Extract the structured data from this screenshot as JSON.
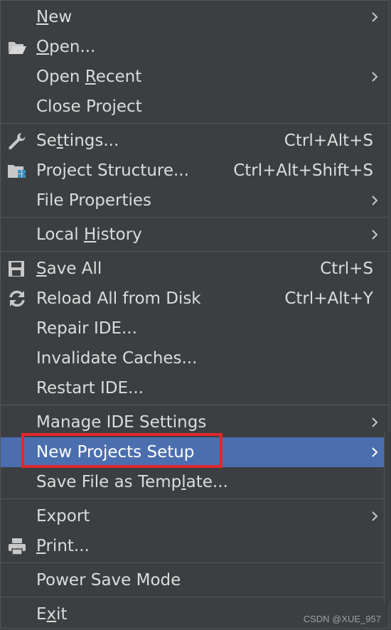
{
  "menu": {
    "new": "New",
    "open": "Open...",
    "open_recent": "Open Recent",
    "close_project": "Close Project",
    "settings": "Settings...",
    "settings_shortcut": "Ctrl+Alt+S",
    "project_structure": "Project Structure...",
    "project_structure_shortcut": "Ctrl+Alt+Shift+S",
    "file_properties": "File Properties",
    "local_history": "Local History",
    "save_all": "Save All",
    "save_all_shortcut": "Ctrl+S",
    "reload_all": "Reload All from Disk",
    "reload_all_shortcut": "Ctrl+Alt+Y",
    "repair_ide": "Repair IDE...",
    "invalidate_caches": "Invalidate Caches...",
    "restart_ide": "Restart IDE...",
    "manage_ide_settings": "Manage IDE Settings",
    "new_projects_setup": "New Projects Setup",
    "save_file_as_template": "Save File as Template...",
    "export": "Export",
    "print": "Print...",
    "power_save_mode": "Power Save Mode",
    "exit": "Exit"
  },
  "icons": {
    "open": "folder-open-icon",
    "settings": "wrench-icon",
    "project_structure": "project-structure-icon",
    "save_all": "floppy-disk-icon",
    "reload_all": "reload-icon",
    "print": "printer-icon",
    "submenu": "chevron-right-icon"
  },
  "colors": {
    "menu_background": "#3c3f41",
    "selected_background": "#4b6eaf",
    "highlight_border": "#e0282d",
    "text": "#dcdcdc"
  },
  "watermark": "CSDN @XUE_957"
}
